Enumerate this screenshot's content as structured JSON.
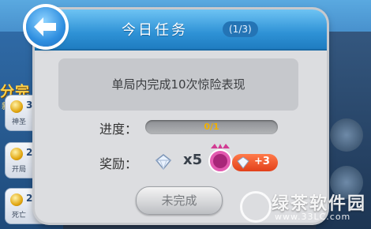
{
  "background": {
    "left_title": "分完",
    "left_sub": "新品",
    "rows": [
      {
        "num": "3",
        "desc": "神圣"
      },
      {
        "num": "2",
        "desc": "开局"
      },
      {
        "num": "2",
        "desc": "死亡"
      }
    ]
  },
  "dialog": {
    "title": "今日任务",
    "page_indicator": "(1/3)",
    "task_description": "单局内完成10次惊险表现",
    "progress_label": "进度：",
    "progress_text": "0/1",
    "progress_fraction": 0,
    "reward_label": "奖励：",
    "reward_multiplier": "x5",
    "bonus_text": "+3",
    "action_button": "未完成"
  },
  "watermark": {
    "name": "绿茶软件园",
    "url": "www.33LC.com"
  },
  "colors": {
    "header_blue": "#2e92d6",
    "bonus_orange": "#e2401a",
    "progress_text_gold": "#f0b000"
  },
  "icons": [
    "back-arrow-icon",
    "diamond-icon",
    "badge-icon",
    "gem-icon"
  ]
}
